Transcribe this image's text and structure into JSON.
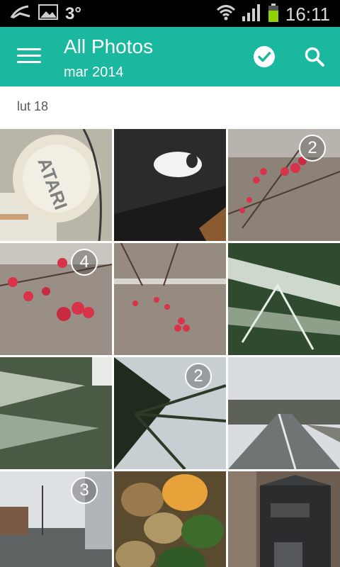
{
  "status_bar": {
    "temperature": "3°",
    "time": "16:11",
    "icons": [
      "notification-icon",
      "gallery-icon",
      "wifi-icon",
      "signal-icon",
      "battery-icon"
    ]
  },
  "app_bar": {
    "title": "All Photos",
    "subtitle": "mar 2014",
    "icons": [
      "menu-icon",
      "check-circle-icon",
      "search-icon"
    ],
    "accent_color": "#1ab89f"
  },
  "section": {
    "label": "lut 18"
  },
  "photos": [
    {
      "subject": "headphones",
      "badge": ""
    },
    {
      "subject": "laptop-logo",
      "badge": ""
    },
    {
      "subject": "red-berries",
      "badge": "2"
    },
    {
      "subject": "red-berries",
      "badge": "4"
    },
    {
      "subject": "red-berries",
      "badge": ""
    },
    {
      "subject": "conifer",
      "badge": ""
    },
    {
      "subject": "conifer",
      "badge": ""
    },
    {
      "subject": "pine-branch",
      "badge": "2"
    },
    {
      "subject": "street",
      "badge": ""
    },
    {
      "subject": "park",
      "badge": "3"
    },
    {
      "subject": "kiwis",
      "badge": ""
    },
    {
      "subject": "mailbox",
      "badge": ""
    }
  ]
}
